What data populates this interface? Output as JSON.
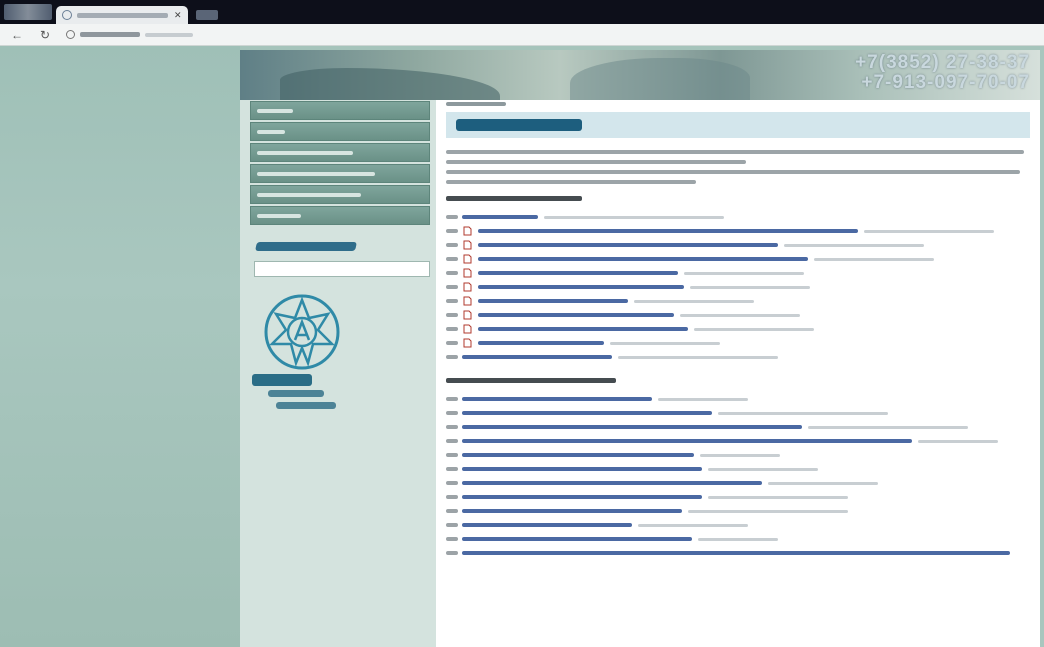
{
  "browser": {
    "tab_title": "",
    "url": ""
  },
  "site": {
    "phones": [
      "+7(3852) 27-38-37",
      "+7-913-097-70-07"
    ]
  },
  "sidebar": {
    "menu_items": [
      "",
      "",
      "",
      "",
      "",
      ""
    ],
    "search_title": "",
    "search_placeholder": "",
    "emblem_caption": ""
  },
  "content": {
    "breadcrumb": "",
    "title": "",
    "section_1": "",
    "section_2": ""
  },
  "colors": {
    "page_bg": "#a6c4bb",
    "menu_green": "#6a9187",
    "title_blue": "#1d5e7e",
    "link_blue": "#2c4f93"
  }
}
